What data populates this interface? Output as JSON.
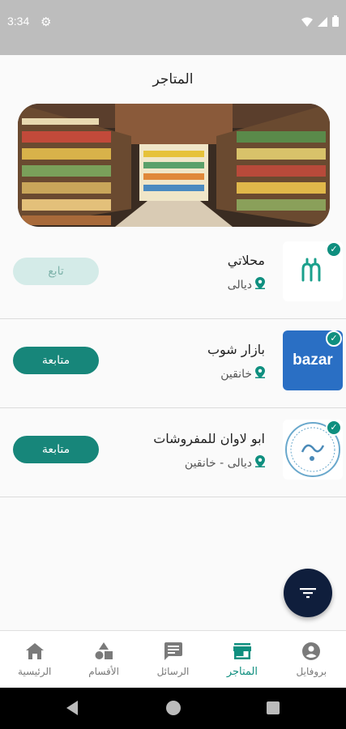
{
  "status_bar": {
    "time": "3:34"
  },
  "page": {
    "title": "المتاجر"
  },
  "stores": [
    {
      "name": "محلاتي",
      "location": "ديالى",
      "button": "تابع",
      "button_state": "following"
    },
    {
      "name": "بازار شوب",
      "location": "خانقين",
      "button": "متابعة",
      "button_state": "active",
      "logo_text": "bazar"
    },
    {
      "name": "ابو لاوان للمفروشات",
      "location": "ديالى - خانقين",
      "button": "متابعة",
      "button_state": "active"
    }
  ],
  "bottom_nav": {
    "items": [
      {
        "label": "بروفايل",
        "icon": "profile-icon"
      },
      {
        "label": "المتاجر",
        "icon": "store-icon",
        "active": true
      },
      {
        "label": "الرسائل",
        "icon": "chat-icon"
      },
      {
        "label": "الأقسام",
        "icon": "categories-icon"
      },
      {
        "label": "الرئيسية",
        "icon": "home-icon"
      }
    ]
  },
  "colors": {
    "accent": "#0f8f7f",
    "fab": "#0f1e3c",
    "status_bar": "#bdbdbd"
  }
}
